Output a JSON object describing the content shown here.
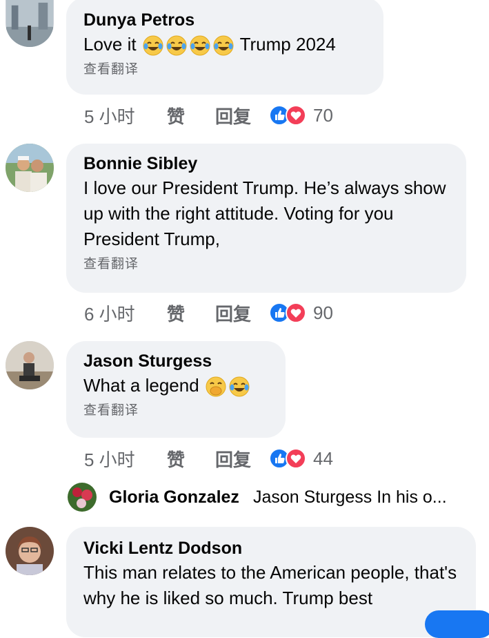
{
  "translate_label": "查看翻译",
  "like_label": "赞",
  "reply_label": "回复",
  "colors": {
    "like_blue": "#1877f2",
    "love_red": "#f33e58",
    "bubble_bg": "#f0f2f5",
    "meta_gray": "#65676b"
  },
  "comments": [
    {
      "author": "Dunya Petros",
      "text_before": "Love it",
      "emojis": [
        "laughing-tears-emoji",
        "laughing-tears-emoji",
        "laughing-tears-emoji",
        "laughing-tears-emoji"
      ],
      "text_after": "Trump 2024",
      "time": "5 小时",
      "reactions": [
        "like",
        "love"
      ],
      "reaction_count": "70"
    },
    {
      "author": "Bonnie Sibley",
      "text": "I love our President Trump. He’s always show up with the right attitude. Voting for you President Trump,",
      "time": "6 小时",
      "reactions": [
        "like",
        "love"
      ],
      "reaction_count": "90"
    },
    {
      "author": "Jason Sturgess",
      "text_before": "What a legend",
      "emojis": [
        "hand-over-mouth-emoji",
        "laughing-tears-emoji"
      ],
      "time": "5 小时",
      "reactions": [
        "like",
        "love"
      ],
      "reaction_count": "44"
    },
    {
      "author": "Vicki Lentz Dodson",
      "text": "This man relates to the American people, that's why he is liked so much. Trump best"
    }
  ],
  "reply_preview": {
    "author": "Gloria Gonzalez",
    "text": "Jason Sturgess  In his o..."
  }
}
